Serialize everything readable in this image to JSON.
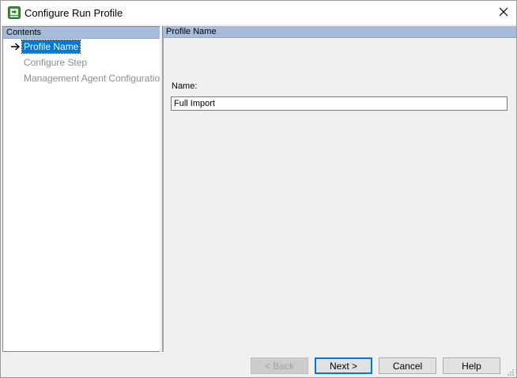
{
  "window": {
    "title": "Configure Run Profile",
    "icon": "run-profile-app-icon",
    "close_icon": "close-icon"
  },
  "left_pane": {
    "header": "Contents",
    "items": [
      {
        "label": "Profile Name",
        "state": "active"
      },
      {
        "label": "Configure Step",
        "state": "disabled"
      },
      {
        "label": "Management Agent Configuration",
        "state": "disabled"
      }
    ],
    "active_indicator_icon": "arrow-right-icon"
  },
  "right_pane": {
    "header": "Profile Name",
    "name_label": "Name:",
    "name_value": "Full Import"
  },
  "buttons": {
    "back": "< Back",
    "next": "Next >",
    "cancel": "Cancel",
    "help": "Help"
  },
  "colors": {
    "header_bg": "#a7bbdb",
    "selection": "#0078d7",
    "disabled_text": "#8d8d8d"
  }
}
